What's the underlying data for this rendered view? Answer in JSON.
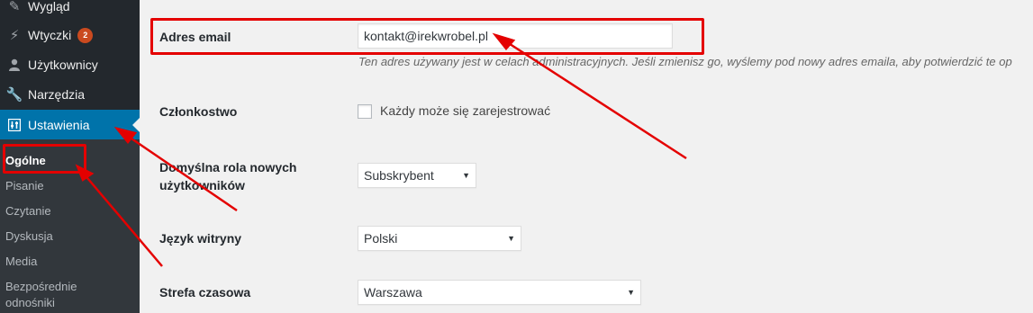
{
  "sidebar": {
    "items": [
      {
        "label": "Wygląd",
        "icon": "paintbrush-icon"
      },
      {
        "label": "Wtyczki",
        "icon": "plugin-icon",
        "badge": "2"
      },
      {
        "label": "Użytkownicy",
        "icon": "users-icon"
      },
      {
        "label": "Narzędzia",
        "icon": "wrench-icon"
      },
      {
        "label": "Ustawienia",
        "icon": "settings-icon"
      }
    ],
    "submenu": [
      "Ogólne",
      "Pisanie",
      "Czytanie",
      "Dyskusja",
      "Media",
      "Bezpośrednie",
      "odnośniki"
    ]
  },
  "form": {
    "email_label": "Adres email",
    "email_value": "kontakt@irekwrobel.pl",
    "email_desc": "Ten adres używany jest w celach administracyjnych. Jeśli zmienisz go, wyślemy pod nowy adres emaila, aby potwierdzić te op",
    "membership_label": "Członkostwo",
    "membership_checkbox": "Każdy może się zarejestrować",
    "role_label_1": "Domyślna rola nowych",
    "role_label_2": "użytkowników",
    "role_value": "Subskrybent",
    "lang_label": "Język witryny",
    "lang_value": "Polski",
    "tz_label": "Strefa czasowa",
    "tz_value": "Warszawa"
  },
  "colors": {
    "sidebar": "#23282d",
    "submenu": "#32373c",
    "accent": "#0073aa",
    "badge": "#ca4a1f",
    "annotation": "#e40000"
  }
}
